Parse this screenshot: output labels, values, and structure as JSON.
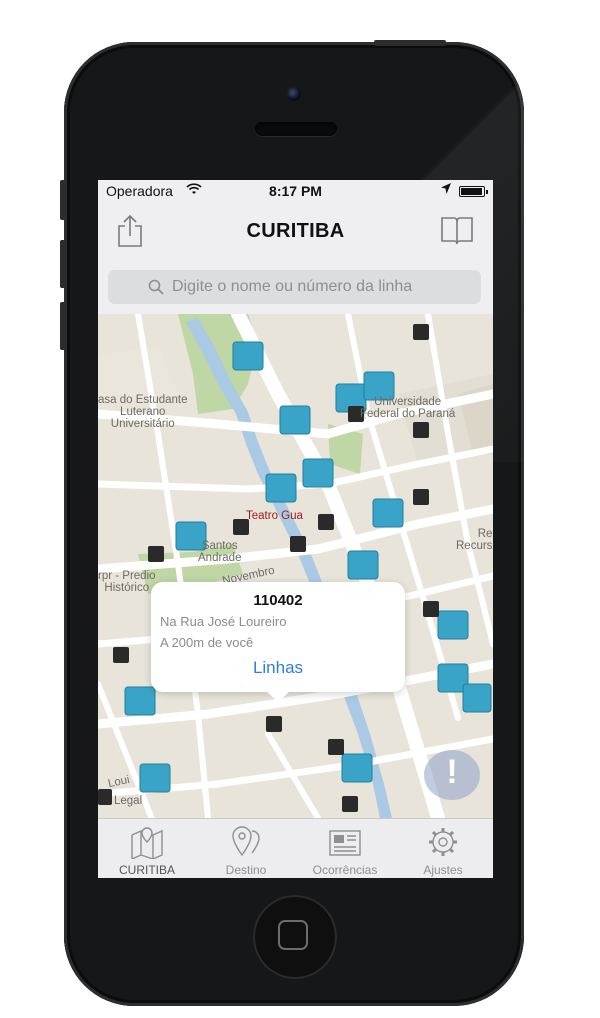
{
  "status_bar": {
    "carrier": "Operadora",
    "time": "8:17 PM"
  },
  "nav": {
    "title": "CURITIBA",
    "share_icon": "share-icon",
    "book_icon": "book-icon"
  },
  "search": {
    "placeholder": "Digite o nome ou número da linha"
  },
  "map": {
    "labels": [
      "asa do Estudante\nLuterano\nUniversitário",
      "Universidade\nFederal do Paraná",
      "Teatro Gua",
      "Santos\nAndrade",
      "rpr - Predio\nHistórico",
      "Novembro",
      "Re\nRecurs",
      "Loui",
      "Legal"
    ],
    "callout": {
      "code": "110402",
      "address": "Na Rua José Loureiro",
      "distance": "A 200m de você",
      "link_label": "Linhas"
    },
    "marker_color": "#3aa4c8",
    "alert_icon": "!"
  },
  "tabs": [
    {
      "label": "CURITIBA",
      "icon": "map-icon",
      "selected": true
    },
    {
      "label": "Destino",
      "icon": "location-pin-icon",
      "selected": false
    },
    {
      "label": "Ocorrências",
      "icon": "newspaper-icon",
      "selected": false
    },
    {
      "label": "Ajustes",
      "icon": "gear-icon",
      "selected": false
    }
  ]
}
